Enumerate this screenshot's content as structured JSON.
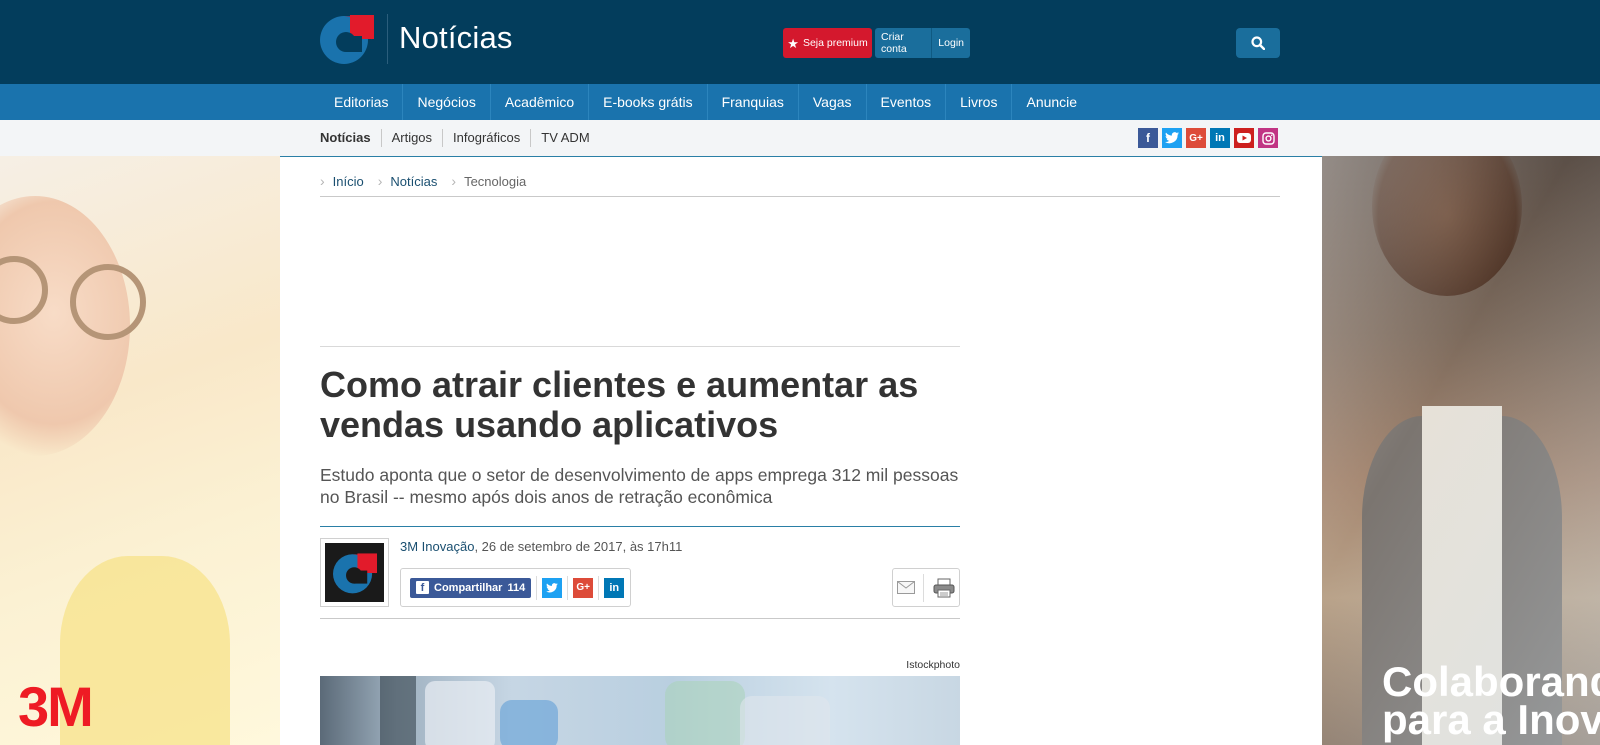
{
  "header": {
    "site_title": "Notícias",
    "premium_label": "Seja premium",
    "create_account_label": "Criar conta",
    "login_label": "Login"
  },
  "main_nav": [
    "Editorias",
    "Negócios",
    "Acadêmico",
    "E-books grátis",
    "Franquias",
    "Vagas",
    "Eventos",
    "Livros",
    "Anuncie"
  ],
  "sub_nav": [
    "Notícias",
    "Artigos",
    "Infográficos",
    "TV ADM"
  ],
  "social_icons": [
    "facebook-icon",
    "twitter-icon",
    "google-plus-icon",
    "linkedin-icon",
    "youtube-icon",
    "instagram-icon"
  ],
  "breadcrumb": [
    "Início",
    "Notícias",
    "Tecnologia"
  ],
  "article": {
    "headline": "Como atrair clientes e aumentar as vendas usando aplicativos",
    "subheadline": "Estudo aponta que o setor de desenvolvimento de apps emprega 312 mil pessoas no Brasil -- mesmo após dois anos de retração econômica",
    "author": "3M Inovação",
    "date_text": ", 26 de setembro de 2017, às 17h11",
    "share_label": "Compartilhar",
    "share_count": "114",
    "photo_credit": "Istockphoto"
  },
  "ads": {
    "left_brand": "3M",
    "right_text_line1": "Colaborand",
    "right_text_line2": "para a Inova"
  },
  "colors": {
    "header_bg": "#033d5c",
    "nav_bg": "#1a73ad",
    "premium_red": "#d4182d",
    "link_blue": "#1a4f70"
  }
}
